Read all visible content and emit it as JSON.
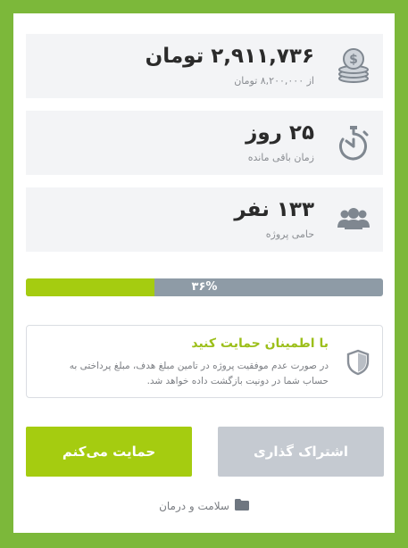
{
  "stats": [
    {
      "icon": "coins-icon",
      "value": "۲,۹۱۱,۷۳۶ تومان",
      "label": "از ۸,۲۰۰,۰۰۰ تومان"
    },
    {
      "icon": "stopwatch-icon",
      "value": "۲۵ روز",
      "label": "زمان باقی مانده"
    },
    {
      "icon": "users-icon",
      "value": "۱۳۳ نفر",
      "label": "حامی پروژه"
    }
  ],
  "progress": {
    "percent": 36,
    "label": "۳۶%"
  },
  "guarantee": {
    "icon": "shield-icon",
    "title": "با اطمینان حمایت کنید",
    "text": "در صورت عدم موفقیت پروژه در تامین مبلغ هدف، مبلغ پرداختی به حساب شما در دونیت بازگشت داده خواهد شد."
  },
  "buttons": {
    "support": "حمایت می‌کنم",
    "share": "اشتراک گذاری"
  },
  "category": {
    "icon": "folder-icon",
    "label": "سلامت و درمان"
  },
  "colors": {
    "background": "#7cb83a",
    "accent": "#a5cc10",
    "progress_track": "#8e9ba6",
    "share_button": "#c5cad1"
  }
}
